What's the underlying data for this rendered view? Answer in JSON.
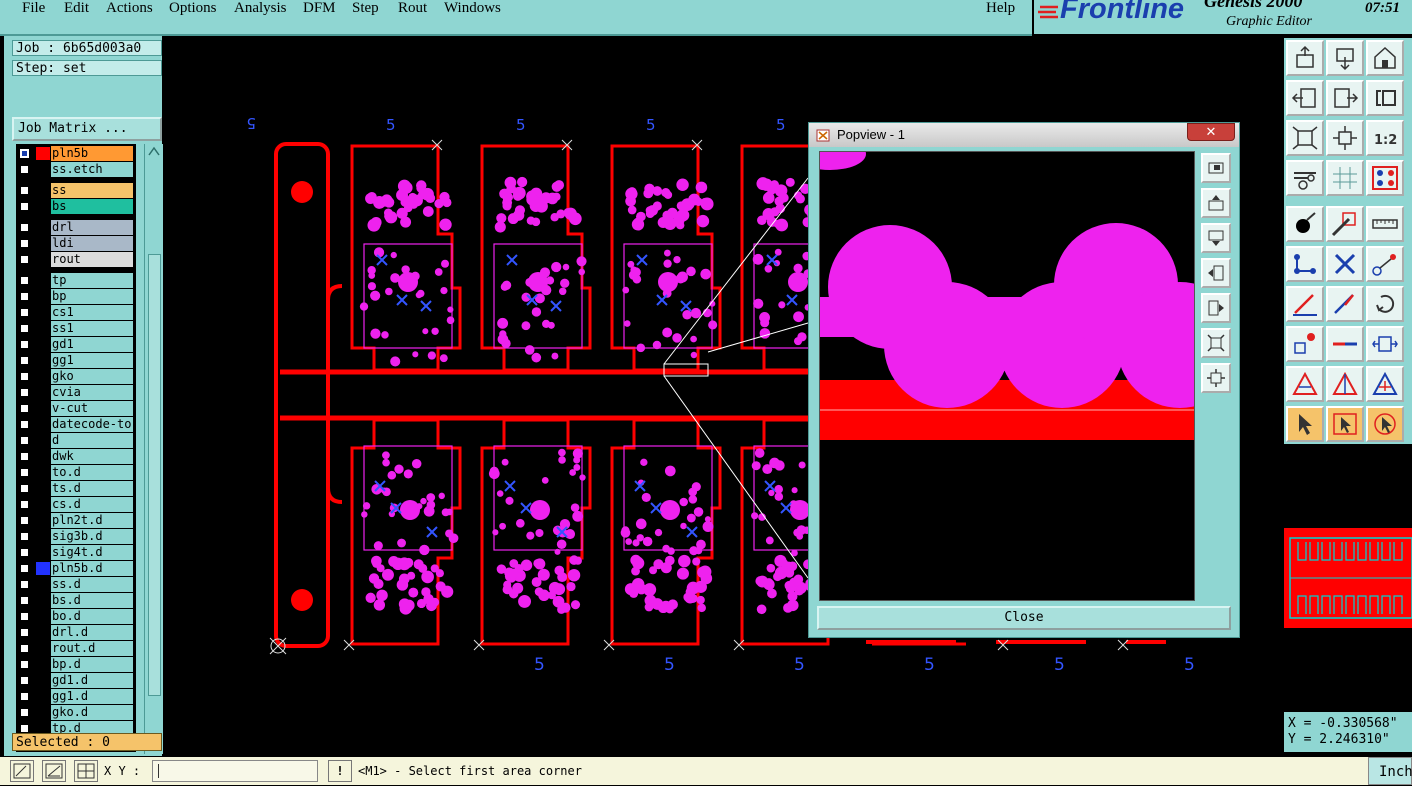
{
  "menu": {
    "file": "File",
    "edit": "Edit",
    "actions": "Actions",
    "options": "Options",
    "analysis": "Analysis",
    "dfm": "DFM",
    "step": "Step",
    "rout": "Rout",
    "windows": "Windows",
    "help": "Help"
  },
  "brand": {
    "logo": "Frontline",
    "product": "Genesis 2000",
    "subtitle": "Graphic Editor",
    "clock": "07:51"
  },
  "job": {
    "job_label": "Job : 6b65d003a0",
    "step_label": "Step: set",
    "job_matrix_button": "Job Matrix ..."
  },
  "layers": [
    {
      "name": "pln5b",
      "color": "#ff9933",
      "swatch": "#ff0000",
      "checked": true
    },
    {
      "name": "ss.etch",
      "color": "#8fd6d2",
      "swatch": "",
      "checked": false
    },
    {
      "name": "ss",
      "color": "#f5c36a",
      "swatch": "",
      "checked": false
    },
    {
      "name": "bs",
      "color": "#1fbf9f",
      "swatch": "",
      "checked": false
    },
    {
      "name": "drl",
      "color": "#a9b8c8",
      "swatch": "",
      "checked": false
    },
    {
      "name": "ldi",
      "color": "#a9b8c8",
      "swatch": "",
      "checked": false
    },
    {
      "name": "rout",
      "color": "#dcdcdc",
      "swatch": "",
      "checked": false
    },
    {
      "name": "tp",
      "color": "#8fd6d2",
      "swatch": "",
      "checked": false
    },
    {
      "name": "bp",
      "color": "#8fd6d2",
      "swatch": "",
      "checked": false
    },
    {
      "name": "cs1",
      "color": "#8fd6d2",
      "swatch": "",
      "checked": false
    },
    {
      "name": "ss1",
      "color": "#8fd6d2",
      "swatch": "",
      "checked": false
    },
    {
      "name": "gd1",
      "color": "#8fd6d2",
      "swatch": "",
      "checked": false
    },
    {
      "name": "gg1",
      "color": "#8fd6d2",
      "swatch": "",
      "checked": false
    },
    {
      "name": "gko",
      "color": "#8fd6d2",
      "swatch": "",
      "checked": false
    },
    {
      "name": "cvia",
      "color": "#8fd6d2",
      "swatch": "",
      "checked": false
    },
    {
      "name": "v-cut",
      "color": "#8fd6d2",
      "swatch": "",
      "checked": false
    },
    {
      "name": "datecode-to",
      "color": "#8fd6d2",
      "swatch": "",
      "checked": false
    },
    {
      "name": "d",
      "color": "#8fd6d2",
      "swatch": "",
      "checked": false
    },
    {
      "name": "dwk",
      "color": "#8fd6d2",
      "swatch": "",
      "checked": false
    },
    {
      "name": "to.d",
      "color": "#8fd6d2",
      "swatch": "",
      "checked": false
    },
    {
      "name": "ts.d",
      "color": "#8fd6d2",
      "swatch": "",
      "checked": false
    },
    {
      "name": "cs.d",
      "color": "#8fd6d2",
      "swatch": "",
      "checked": false
    },
    {
      "name": "pln2t.d",
      "color": "#8fd6d2",
      "swatch": "",
      "checked": false
    },
    {
      "name": "sig3b.d",
      "color": "#8fd6d2",
      "swatch": "",
      "checked": false
    },
    {
      "name": "sig4t.d",
      "color": "#8fd6d2",
      "swatch": "",
      "checked": false
    },
    {
      "name": "pln5b.d",
      "color": "#8fd6d2",
      "swatch": "#2233ff",
      "checked": false
    },
    {
      "name": "ss.d",
      "color": "#8fd6d2",
      "swatch": "",
      "checked": false
    },
    {
      "name": "bs.d",
      "color": "#8fd6d2",
      "swatch": "",
      "checked": false
    },
    {
      "name": "bo.d",
      "color": "#8fd6d2",
      "swatch": "",
      "checked": false
    },
    {
      "name": "drl.d",
      "color": "#8fd6d2",
      "swatch": "",
      "checked": false
    },
    {
      "name": "rout.d",
      "color": "#8fd6d2",
      "swatch": "",
      "checked": false
    },
    {
      "name": "bp.d",
      "color": "#8fd6d2",
      "swatch": "",
      "checked": false
    },
    {
      "name": "gd1.d",
      "color": "#8fd6d2",
      "swatch": "",
      "checked": false
    },
    {
      "name": "gg1.d",
      "color": "#8fd6d2",
      "swatch": "",
      "checked": false
    },
    {
      "name": "gko.d",
      "color": "#8fd6d2",
      "swatch": "",
      "checked": false
    },
    {
      "name": "tp.d",
      "color": "#8fd6d2",
      "swatch": "",
      "checked": false
    }
  ],
  "selected": "Selected : 0",
  "canvas": {
    "top_marks": [
      "5",
      "5",
      "5",
      "5",
      "5"
    ],
    "bottom_marks": [
      "5",
      "5",
      "5",
      "5",
      "5",
      "5"
    ]
  },
  "popview": {
    "title": "Popview - 1",
    "close_x": "✕",
    "close_button": "Close"
  },
  "coords": {
    "x": "X = -0.330568\"",
    "y": "Y = 2.246310\""
  },
  "status": {
    "xy_label": "X Y :",
    "xy_value": "",
    "prompt_marker": "!",
    "prompt": "<M1> - Select first area corner",
    "units": "Inch"
  },
  "colors": {
    "panel": "#8fd6d2",
    "pad": "#ee22ee",
    "outline": "#ff0000",
    "mark": "#3355ff"
  }
}
